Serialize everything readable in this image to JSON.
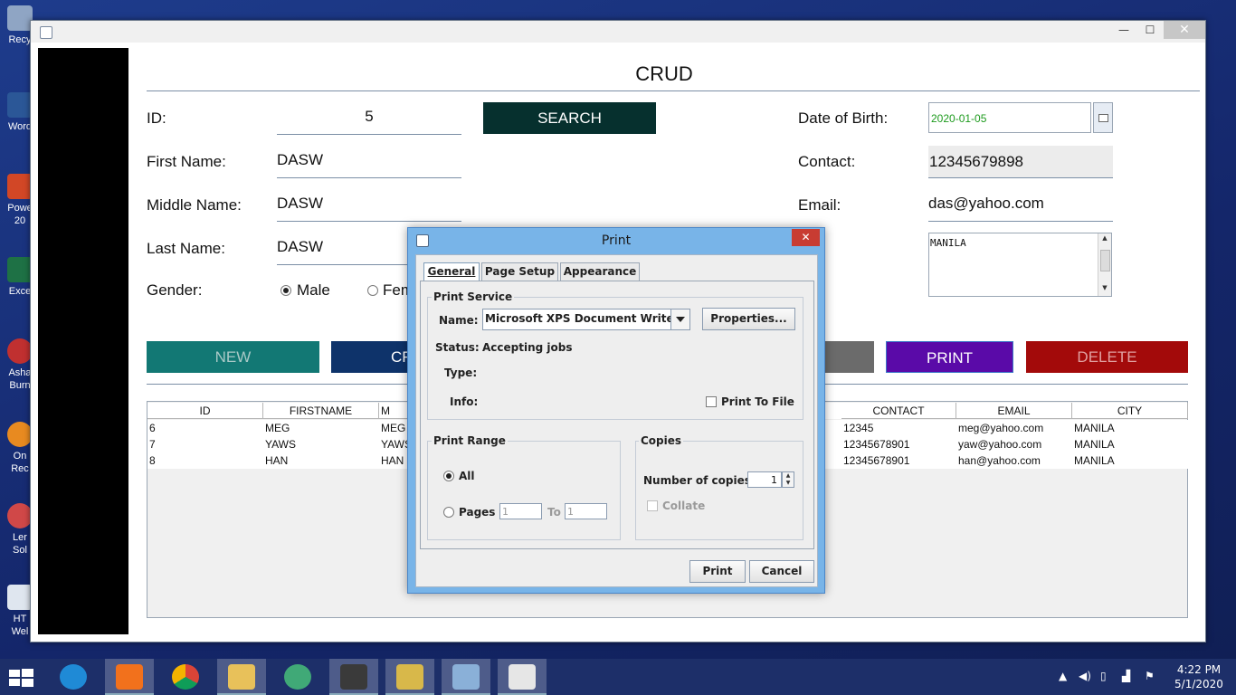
{
  "desktop": {
    "icons": [
      {
        "label": "Recy",
        "icon": "recycle-bin-icon"
      },
      {
        "label": "Word",
        "icon": "word-icon"
      },
      {
        "label": "Powe\n20",
        "icon": "powerpoint-icon"
      },
      {
        "label": "Exce",
        "icon": "excel-icon"
      },
      {
        "label": "Asha\nBurn",
        "icon": "burner-icon"
      },
      {
        "label": "On\nRec",
        "icon": "recorder-icon"
      },
      {
        "label": "Ler\nSol",
        "icon": "app-icon"
      },
      {
        "label": "HT\nWel",
        "icon": "html-icon"
      }
    ]
  },
  "app": {
    "title": "CRUD",
    "labels": {
      "id": "ID:",
      "first_name": "First Name:",
      "middle_name": "Middle Name:",
      "last_name": "Last Name:",
      "gender": "Gender:",
      "dob": "Date of Birth:",
      "contact": "Contact:",
      "email": "Email:"
    },
    "values": {
      "id": "5",
      "first_name": "DASW",
      "middle_name": "DASW",
      "last_name": "DASW",
      "dob": "2020-01-05",
      "contact": "12345679898",
      "email": "das@yahoo.com",
      "address": "MANILA"
    },
    "gender": {
      "male": "Male",
      "female": "Fem",
      "selected": "Male"
    },
    "buttons": {
      "search": "SEARCH",
      "new": "NEW",
      "create": "CR",
      "print": "PRINT",
      "delete": "DELETE"
    },
    "colors": {
      "search": "#06302e",
      "new": "#127874",
      "create": "#0e336a",
      "update": "#6b6b6b",
      "print": "#5a0aa8",
      "delete": "#a30a0a",
      "dob_text": "#1e9b1e"
    },
    "table": {
      "columns": [
        "ID",
        "FIRSTNAME",
        "M",
        "CONTACT",
        "EMAIL",
        "CITY"
      ],
      "rows": [
        {
          "id": "6",
          "firstname": "MEG",
          "m": "MEG",
          "contact": "12345",
          "email": "meg@yahoo.com",
          "city": "MANILA"
        },
        {
          "id": "7",
          "firstname": "YAWS",
          "m": "YAWS",
          "contact": "12345678901",
          "email": "yaw@yahoo.com",
          "city": "MANILA"
        },
        {
          "id": "8",
          "firstname": "HAN",
          "m": "HAN",
          "contact": "12345678901",
          "email": "han@yahoo.com",
          "city": "MANILA"
        }
      ]
    }
  },
  "dialog": {
    "title": "Print",
    "close": "✕",
    "tabs": [
      "General",
      "Page Setup",
      "Appearance"
    ],
    "print_service": {
      "title": "Print Service",
      "name_label": "Name:",
      "name_value": "Microsoft XPS Document Writer",
      "properties": "Properties...",
      "status_label": "Status:",
      "status_value": "Accepting jobs",
      "type_label": "Type:",
      "info_label": "Info:",
      "print_to_file": "Print To File"
    },
    "print_range": {
      "title": "Print Range",
      "all": "All",
      "pages": "Pages",
      "from": "1",
      "to_label": "To",
      "to": "1"
    },
    "copies": {
      "title": "Copies",
      "number_label": "Number of copies:",
      "number": "1",
      "collate": "Collate"
    },
    "buttons": {
      "print": "Print",
      "cancel": "Cancel"
    }
  },
  "taskbar": {
    "time": "4:22 PM",
    "date": "5/1/2020",
    "apps": [
      "ie-icon",
      "xampp-icon",
      "chrome-icon",
      "file-explorer-icon",
      "atom-icon",
      "sublime-icon",
      "tools-icon",
      "virtualbox-icon",
      "java-icon"
    ]
  }
}
